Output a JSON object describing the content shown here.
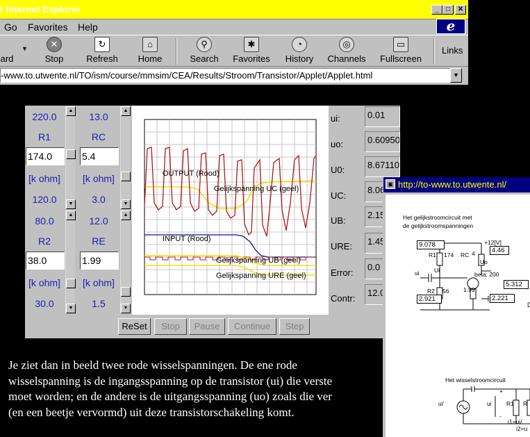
{
  "window": {
    "title": "t Internet Explorer",
    "buttons": {
      "minimize": "_",
      "maximize": "□",
      "close": "✕"
    }
  },
  "menu": {
    "items": [
      "Go",
      "Favorites",
      "Help"
    ]
  },
  "toolbar": {
    "buttons": [
      {
        "label": "ard",
        "icon": "back-arrow-icon"
      },
      {
        "label": "Stop",
        "icon": "stop-icon"
      },
      {
        "label": "Refresh",
        "icon": "refresh-icon"
      },
      {
        "label": "Home",
        "icon": "home-icon"
      },
      {
        "label": "Search",
        "icon": "search-icon"
      },
      {
        "label": "Favorites",
        "icon": "favorites-icon"
      },
      {
        "label": "History",
        "icon": "history-icon"
      },
      {
        "label": "Channels",
        "icon": "channels-icon"
      },
      {
        "label": "Fullscreen",
        "icon": "fullscreen-icon"
      }
    ],
    "links_label": "Links"
  },
  "address": {
    "url": "-www.to.utwente.nl/TO/ism/course/mmsim/CEA/Results/Stroom/Transistor/Applet/Applet.html"
  },
  "applet": {
    "left_column": {
      "top_value": "220.0",
      "param1_name": "R1",
      "param1_value": "174.0",
      "unit1": "[k ohm]",
      "bottom_value": "120.0",
      "top_value2": "80.0",
      "param2_name": "R2",
      "param2_value": "38.0",
      "unit2": "[k ohm]",
      "bottom_value2": "30.0"
    },
    "mid_column": {
      "top_value": "13.0",
      "param1_name": "RC",
      "param1_value": "5.4",
      "unit1": "[k ohm]",
      "bottom_value": "3.0",
      "top_value2": "12.0",
      "param2_name": "RE",
      "param2_value": "1.99",
      "unit2": "[k ohm]",
      "bottom_value2": "1.5"
    },
    "plot_labels": {
      "output": "OUTPUT (Rood)",
      "uc": "Gelijkspanning UC (geel)",
      "input": "INPUT (Rood)",
      "ub": "Gelijkspanning UB (geel)",
      "ure": "Gelijkspanning URE (geel)"
    },
    "readouts": [
      {
        "label": "ui:",
        "value": "0.01"
      },
      {
        "label": "uo:",
        "value": "0.60950"
      },
      {
        "label": "U0:",
        "value": "8.67110"
      },
      {
        "label": "UC:",
        "value": "8.06"
      },
      {
        "label": "UB:",
        "value": "2.15"
      },
      {
        "label": "URE:",
        "value": "1.45"
      },
      {
        "label": "Error:",
        "value": "0.0"
      },
      {
        "label": "Contr:",
        "value": "12.0"
      }
    ],
    "buttons": [
      "ReSet",
      "Stop",
      "Pause",
      "Continue",
      "Step"
    ]
  },
  "paragraph": [
    "Je ziet dan in beeld twee rode wisselspanningen. De ene rode",
    "wisselspanning is de ingangsspanning op de transistor (ui) die verste",
    "moet worden; en de andere is de uitgangsspanning (uo) zoals die ver",
    "(en een beetje vervormd) uit deze transistorschakeling komt."
  ],
  "popup": {
    "title": "http://to-www.to.utwente.nl/",
    "dc_title1": "Het gelijkstroomcircuit met",
    "dc_title2": "de gelijkstroomspanningen",
    "v_supply": "+12[V]",
    "r1_label": "R1",
    "r1_value": "174",
    "rc_label": "RC",
    "rc_value": "4",
    "uo_label": "Uo",
    "ui_label": "ui",
    "ui_cap_label": "Ui",
    "beta": "beta: 200",
    "r2_label": "R2",
    "r2_value": "56",
    "re_value": "1.99",
    "box_top_left": "9.078",
    "box_rc": "4.46",
    "box_right": "5.312",
    "box_bottom_left": "2.921",
    "box_bottom_mid": "2.221",
    "ac_title": "Het wisselstroomcircuit",
    "ac_src": "ui'",
    "ac_ui": "ui",
    "ac_r1": "R1",
    "ac_r": "R",
    "ac_eq1": "i1=ui/",
    "ac_eq2": "i2=u",
    "ac_minus": "-",
    "ac_plus": "+",
    "right_d": "D"
  },
  "colors": {
    "titlebar": "#ffff00",
    "chrome": "#c0c0c0",
    "label_blue": "#1c1cb4",
    "output_red": "#b01818",
    "input_blue": "#101090",
    "dc_yellow": "#f0e000"
  }
}
